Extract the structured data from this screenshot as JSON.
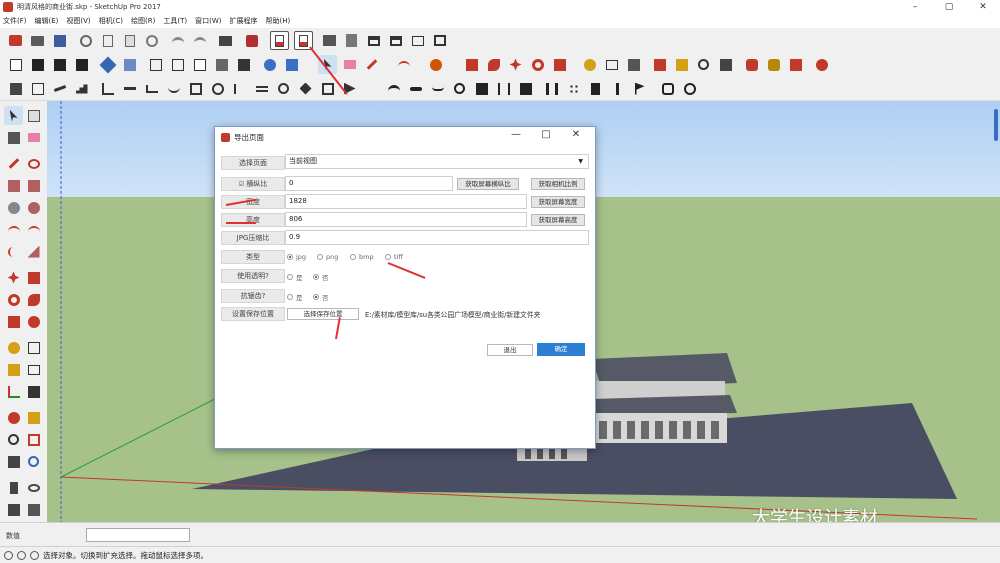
{
  "window": {
    "title": "明清风格的商业街.skp - SketchUp Pro 2017",
    "controls": [
      "–",
      "▢",
      "✕"
    ]
  },
  "menu": [
    "文件(F)",
    "编辑(E)",
    "视图(V)",
    "相机(C)",
    "绘图(R)",
    "工具(T)",
    "窗口(W)",
    "扩展程序",
    "帮助(H)"
  ],
  "measurements": {
    "label": "数值",
    "value": ""
  },
  "status": {
    "text": "选择对象。切换到扩充选择。拖动鼠标选择多项。"
  },
  "dialog": {
    "title": "导出页面",
    "controls": [
      "—",
      "□",
      "✕"
    ],
    "select_page": {
      "label": "选择页面",
      "value": "当前视图"
    },
    "aspect": {
      "label": "横纵比",
      "value": "0",
      "btn1": "获取屏幕横纵比",
      "btn2": "获取相机比例"
    },
    "width": {
      "label": "宽度",
      "value": "1828",
      "btn": "获取屏幕宽度"
    },
    "height": {
      "label": "高度",
      "value": "806",
      "btn": "获取屏幕高度"
    },
    "jpg": {
      "label": "JPG压缩比",
      "value": "0.9"
    },
    "type": {
      "label": "类型",
      "options": [
        "jpg",
        "png",
        "bmp",
        "tiff"
      ],
      "selected": "jpg"
    },
    "transparent": {
      "label": "使用透明?",
      "options": [
        "是",
        "否"
      ],
      "selected": "否"
    },
    "antialias": {
      "label": "抗锯齿?",
      "options": [
        "是",
        "否"
      ],
      "selected": "否"
    },
    "save": {
      "label": "设置保存位置",
      "btn": "选择保存位置",
      "path": "E:/素材库/模型库/su各类公园广场模型/商业街/新建文件夹"
    },
    "cancel": "退出",
    "ok": "确定"
  },
  "watermark": "大学生设计素材",
  "colors": {
    "accent": "#2d7fd3",
    "arrow": "#e03030",
    "platform": "#4a4e63"
  }
}
